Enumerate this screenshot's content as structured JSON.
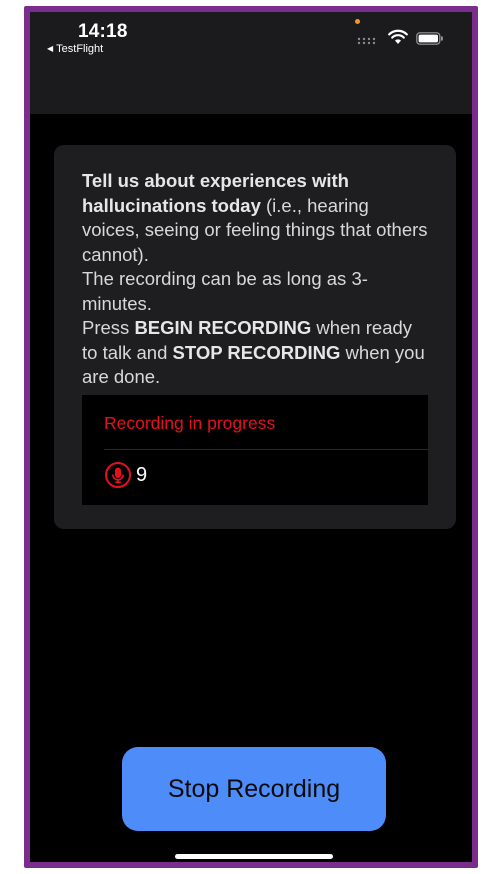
{
  "status_bar": {
    "time": "14:18",
    "back_app": "TestFlight",
    "back_icon": "back-triangle-icon",
    "privacy_dot_color": "#f09a1b"
  },
  "prompt": {
    "bold_1": "Tell us about experiences with hallucinations today",
    "text_1": " (i.e., hearing voices, seeing or feeling things that others cannot).",
    "text_2": "The recording can be as long as 3-minutes.",
    "text_3a": "Press ",
    "bold_3b": "BEGIN RECORDING",
    "text_3c": " when ready to talk and ",
    "bold_3d": "STOP RECORDING",
    "text_3e": " when you are done."
  },
  "recording": {
    "status": "Recording in progress",
    "timer": "9",
    "status_color": "#e5101e",
    "icon": "microphone-icon"
  },
  "actions": {
    "stop_label": "Stop Recording",
    "button_color": "#4d8cf9"
  },
  "colors": {
    "frame": "#7b2d8e",
    "background": "#000000",
    "card": "#1e1e20"
  }
}
